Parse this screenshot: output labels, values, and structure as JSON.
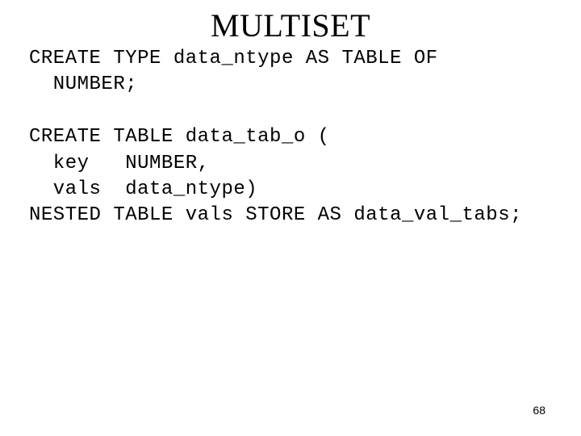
{
  "title": "MULTISET",
  "code_lines": [
    "CREATE TYPE data_ntype AS TABLE OF",
    "  NUMBER;",
    "",
    "CREATE TABLE data_tab_o (",
    "  key   NUMBER,",
    "  vals  data_ntype)",
    "NESTED TABLE vals STORE AS data_val_tabs;"
  ],
  "page_number": "68"
}
